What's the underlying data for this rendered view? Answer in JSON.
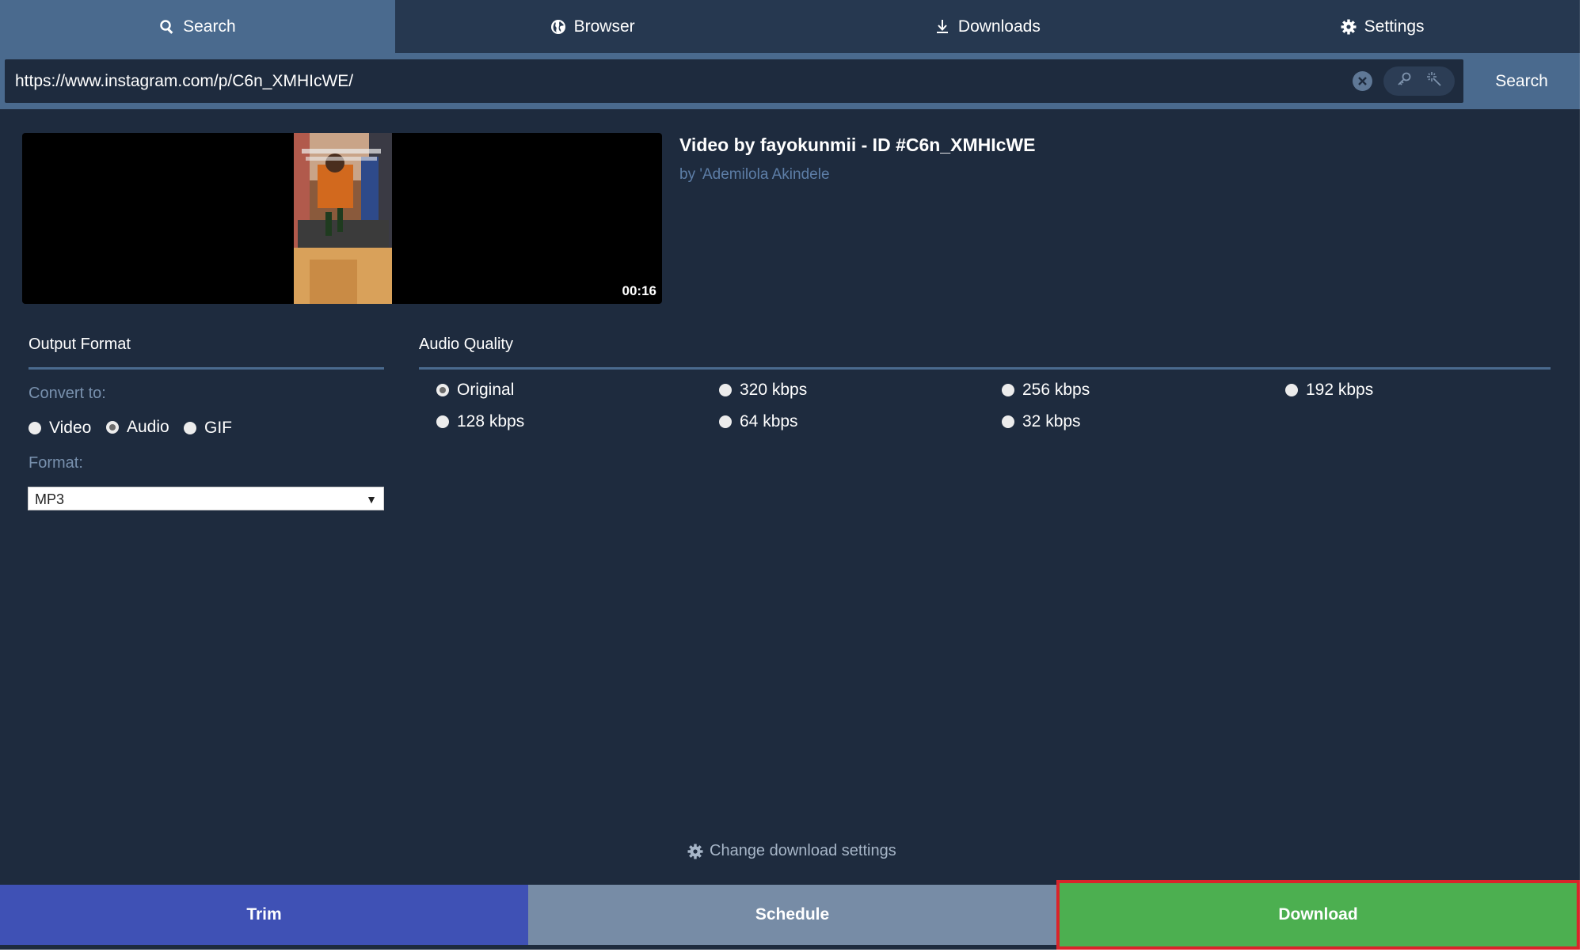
{
  "nav": {
    "tabs": [
      {
        "label": "Search",
        "icon": "search-icon",
        "active": true
      },
      {
        "label": "Browser",
        "icon": "globe-icon",
        "active": false
      },
      {
        "label": "Downloads",
        "icon": "download-icon",
        "active": false
      },
      {
        "label": "Settings",
        "icon": "gear-icon",
        "active": false
      }
    ]
  },
  "search": {
    "url": "https://www.instagram.com/p/C6n_XMHIcWE/",
    "button_label": "Search"
  },
  "media": {
    "duration": "00:16",
    "title": "Video by fayokunmii - ID #C6n_XMHIcWE",
    "author": "by 'Ademilola Akindele"
  },
  "output_format": {
    "title": "Output Format",
    "convert_label": "Convert to:",
    "options": [
      {
        "label": "Video",
        "checked": false
      },
      {
        "label": "Audio",
        "checked": true
      },
      {
        "label": "GIF",
        "checked": false
      }
    ],
    "format_label": "Format:",
    "format_value": "MP3"
  },
  "audio_quality": {
    "title": "Audio Quality",
    "options": [
      {
        "label": "Original",
        "checked": true
      },
      {
        "label": "320 kbps",
        "checked": false
      },
      {
        "label": "256 kbps",
        "checked": false
      },
      {
        "label": "192 kbps",
        "checked": false
      },
      {
        "label": "128 kbps",
        "checked": false
      },
      {
        "label": "64 kbps",
        "checked": false
      },
      {
        "label": "32 kbps",
        "checked": false
      }
    ]
  },
  "change_settings_label": "Change download settings",
  "actions": {
    "trim": "Trim",
    "schedule": "Schedule",
    "download": "Download"
  },
  "colors": {
    "background": "#1e2b3e",
    "nav": "#263850",
    "accent": "#4a6a8e",
    "trim": "#3f51b5",
    "schedule": "#778ca6",
    "download": "#4caf50",
    "highlight_border": "#d9242a"
  }
}
